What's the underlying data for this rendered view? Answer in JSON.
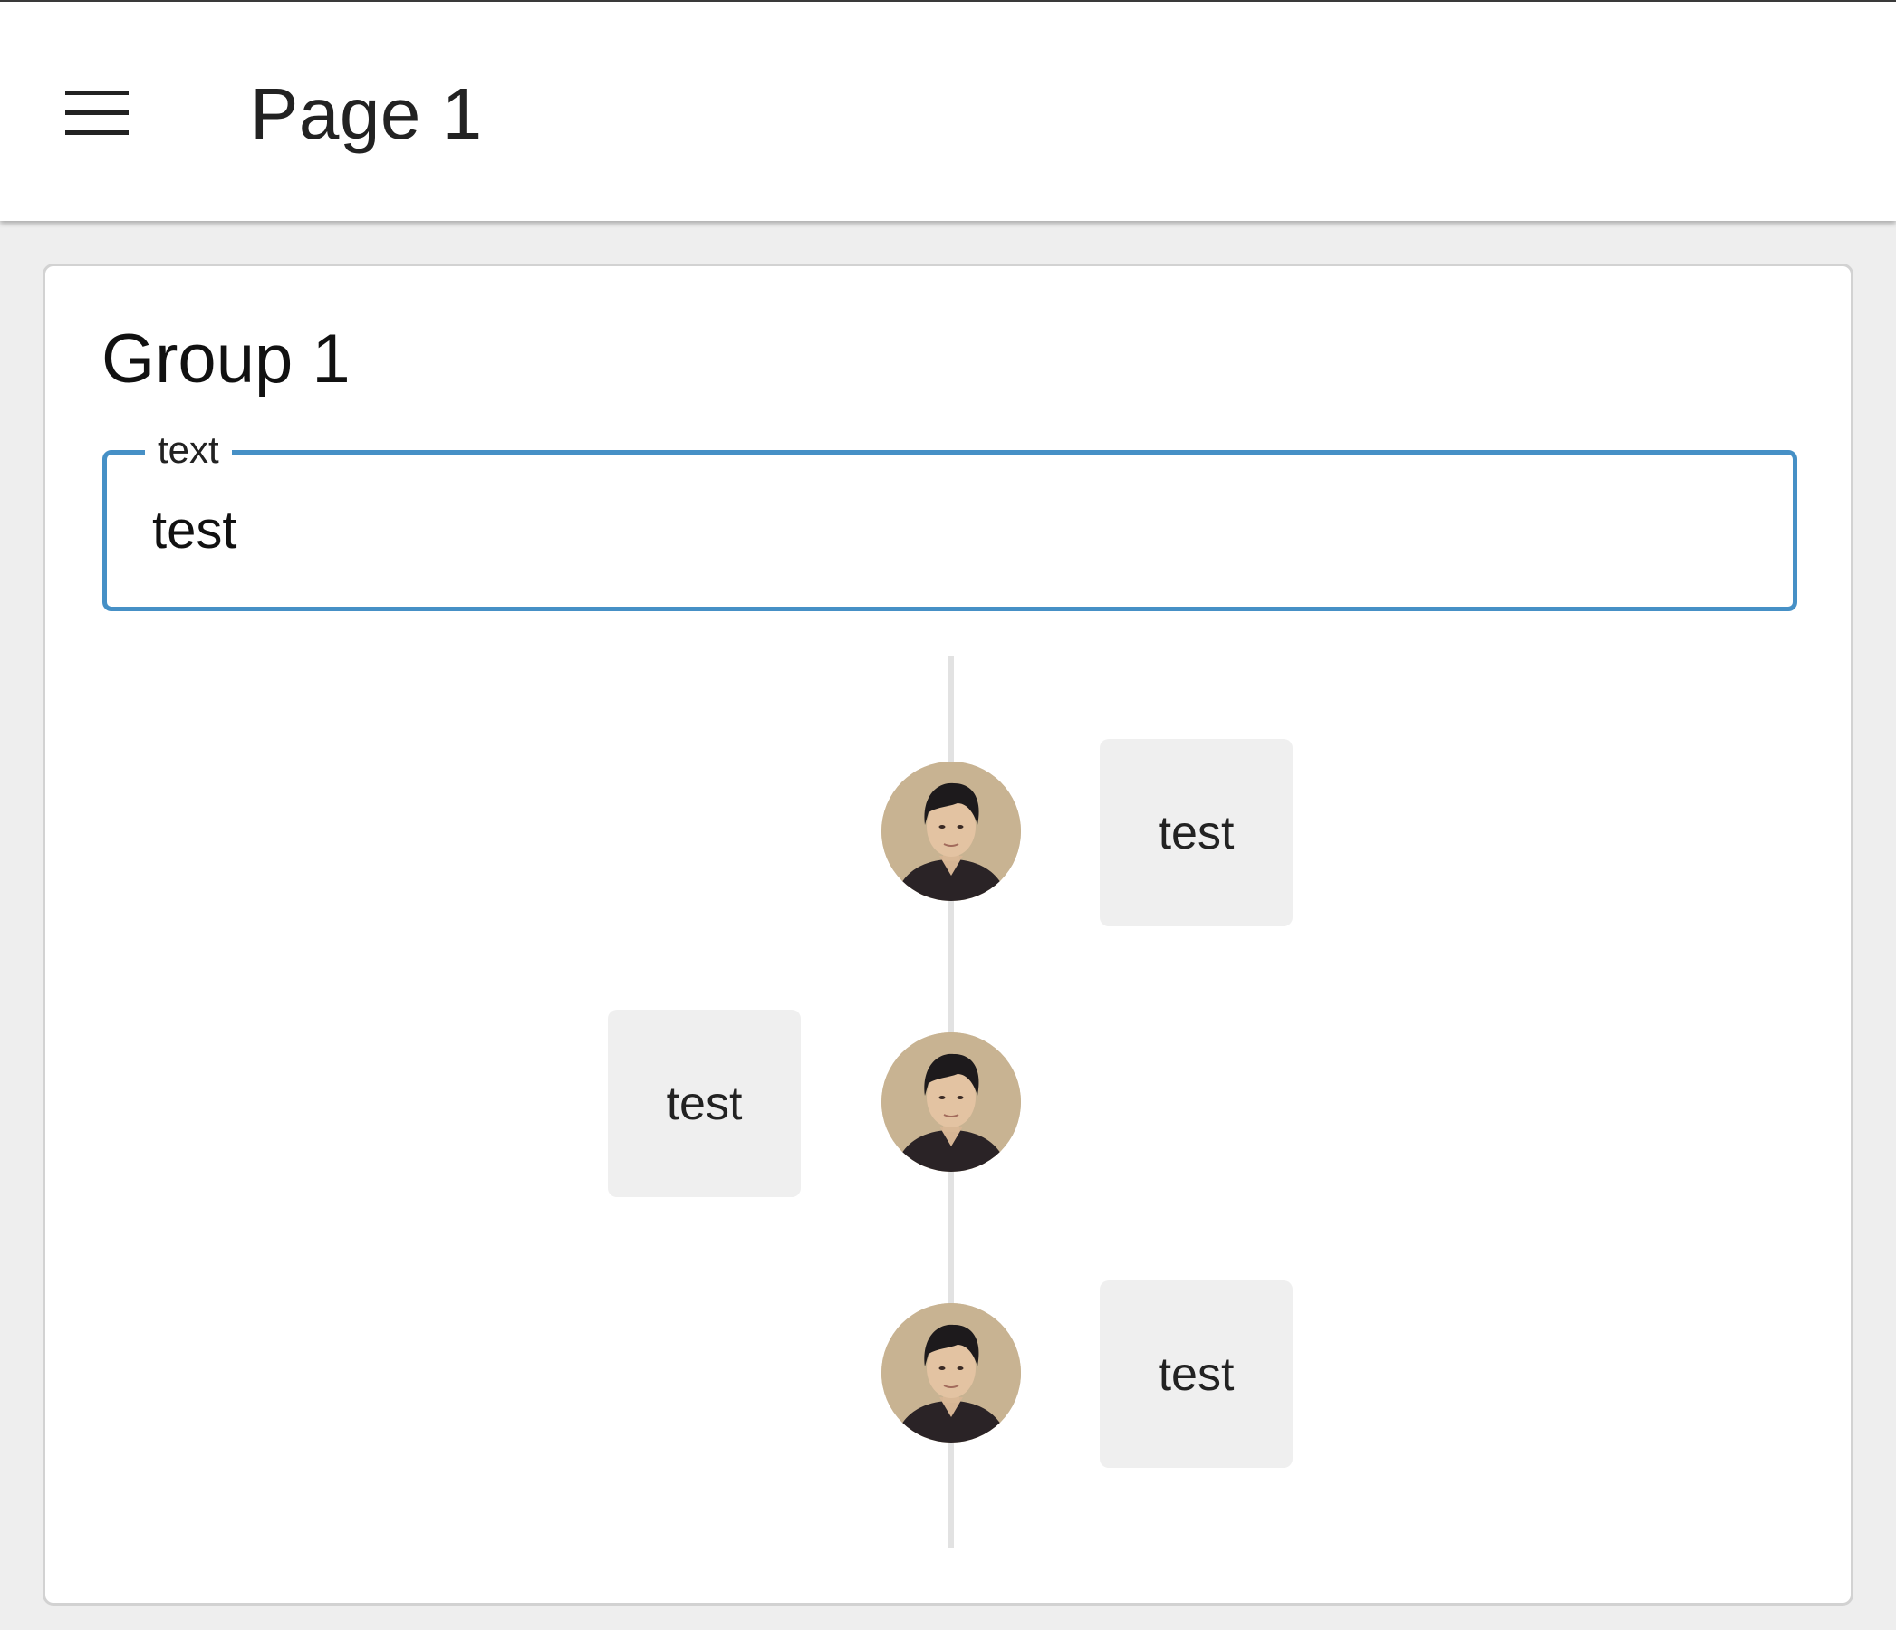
{
  "header": {
    "menu_icon": "hamburger-menu-icon",
    "title": "Page 1"
  },
  "group": {
    "title": "Group 1",
    "field": {
      "label": "text",
      "value": "test"
    }
  },
  "timeline": {
    "items": [
      {
        "text": "test",
        "side": "right",
        "avatar_icon": "avatar-photo"
      },
      {
        "text": "test",
        "side": "left",
        "avatar_icon": "avatar-photo"
      },
      {
        "text": "test",
        "side": "right",
        "avatar_icon": "avatar-photo"
      }
    ]
  },
  "colors": {
    "accent": "#4690c6",
    "background": "#eeeeee",
    "bubble": "#efefef",
    "timeline_line": "#e2e2e2"
  }
}
